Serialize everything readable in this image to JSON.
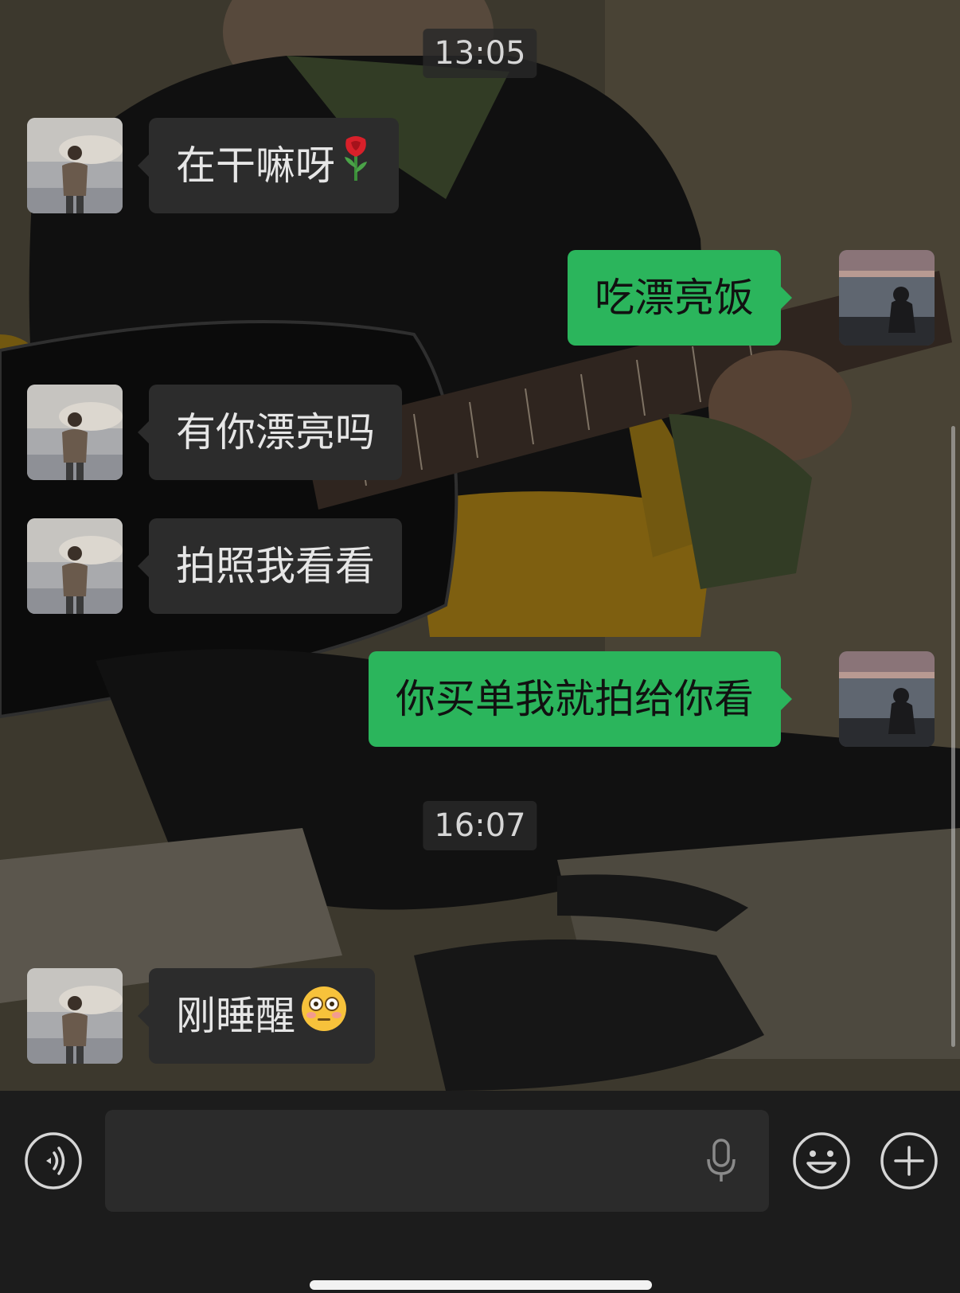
{
  "chat": {
    "timestamps": [
      "13:05",
      "16:07"
    ],
    "messages": [
      {
        "side": "in",
        "text": "在干嘛呀",
        "emoji": "rose"
      },
      {
        "side": "out",
        "text": "吃漂亮饭"
      },
      {
        "side": "in",
        "text": "有你漂亮吗"
      },
      {
        "side": "in",
        "text": "拍照我看看"
      },
      {
        "side": "out",
        "text": "你买单我就拍给你看"
      },
      {
        "side": "in",
        "text": "刚睡醒",
        "emoji": "flushed-face"
      }
    ]
  },
  "input_bar": {
    "text_value": "",
    "icons": [
      "voice-mode-icon",
      "microphone-icon",
      "emoji-icon",
      "add-icon"
    ]
  },
  "colors": {
    "incoming_bubble": "#2c2c2c",
    "outgoing_bubble": "#2bb55c",
    "input_bar": "#1c1c1c"
  }
}
